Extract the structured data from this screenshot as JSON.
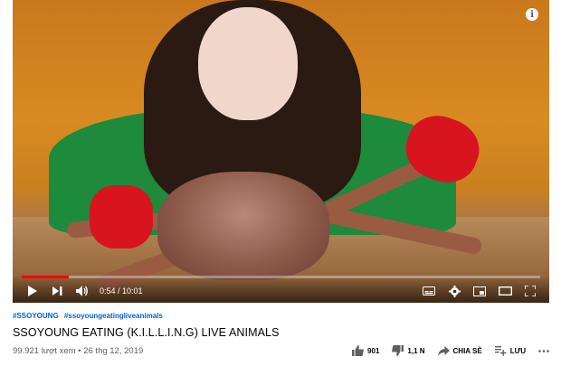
{
  "video": {
    "info_icon": "info-icon",
    "progress_fraction": 0.09,
    "time_label": "0:54 / 10:01",
    "colors": {
      "progress": "#ff0000"
    }
  },
  "meta": {
    "hashtags": [
      "#SSOYOUNG",
      "#ssoyoungeatingliveanimals"
    ],
    "title": "SSOYOUNG EATING (K.I.L.L.I.N.G) LIVE ANIMALS",
    "views_date": "99.921 lượt xem • 26 thg 12, 2019"
  },
  "actions": {
    "like_count": "901",
    "dislike_count": "1,1 N",
    "share_label": "CHIA SẺ",
    "save_label": "LƯU"
  }
}
